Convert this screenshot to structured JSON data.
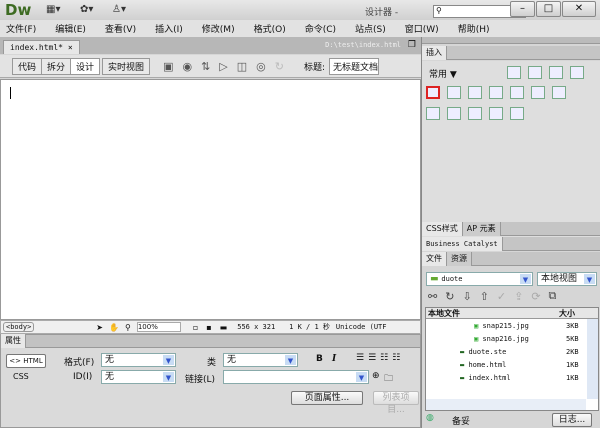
{
  "app": {
    "logo": "Dw",
    "workspace": "设计器 -",
    "search_placeholder": ""
  },
  "window": {
    "minimize": "–",
    "maximize": "□",
    "close": "✕"
  },
  "menu": [
    "文件(F)",
    "编辑(E)",
    "查看(V)",
    "插入(I)",
    "修改(M)",
    "格式(O)",
    "命令(C)",
    "站点(S)",
    "窗口(W)",
    "帮助(H)"
  ],
  "document": {
    "tab": "index.html*",
    "tab_close": "×",
    "path": "D:\\test\\index.html"
  },
  "toolbar": {
    "views": [
      "代码",
      "拆分",
      "设计",
      "实时视图"
    ],
    "active_view": "设计",
    "title_label": "标题:",
    "title_value": "无标题文档"
  },
  "status": {
    "tag": "<body>",
    "zoom": "100%",
    "size": "556 x 321",
    "download": "1 K / 1 秒",
    "encoding": "Unicode (UTF"
  },
  "properties": {
    "title": "属性",
    "html_btn": "<> HTML",
    "css_btn": "CSS",
    "format_label": "格式(F)",
    "format_value": "无",
    "id_label": "ID(I)",
    "id_value": "无",
    "class_label": "类",
    "class_value": "无",
    "link_label": "链接(L)",
    "link_value": "",
    "bold": "B",
    "italic": "I",
    "page_props": "页面属性...",
    "list_item": "列表项目..."
  },
  "insert_panel": {
    "tab": "插入",
    "category": "常用"
  },
  "panels": {
    "css_tab": "CSS样式",
    "ap_tab": "AP 元素",
    "bc": "Business Catalyst",
    "files_tab": "文件",
    "assets_tab": "资源"
  },
  "files": {
    "site": "duote",
    "view": "本地视图",
    "col_name": "本地文件",
    "col_size": "大小",
    "items": [
      {
        "name": "snap215.jpg",
        "size": "3KB"
      },
      {
        "name": "snap216.jpg",
        "size": "5KB"
      },
      {
        "name": "duote.ste",
        "size": "2KB"
      },
      {
        "name": "home.html",
        "size": "1KB"
      },
      {
        "name": "index.html",
        "size": "1KB"
      }
    ],
    "backup": "备妥",
    "log": "日志..."
  }
}
